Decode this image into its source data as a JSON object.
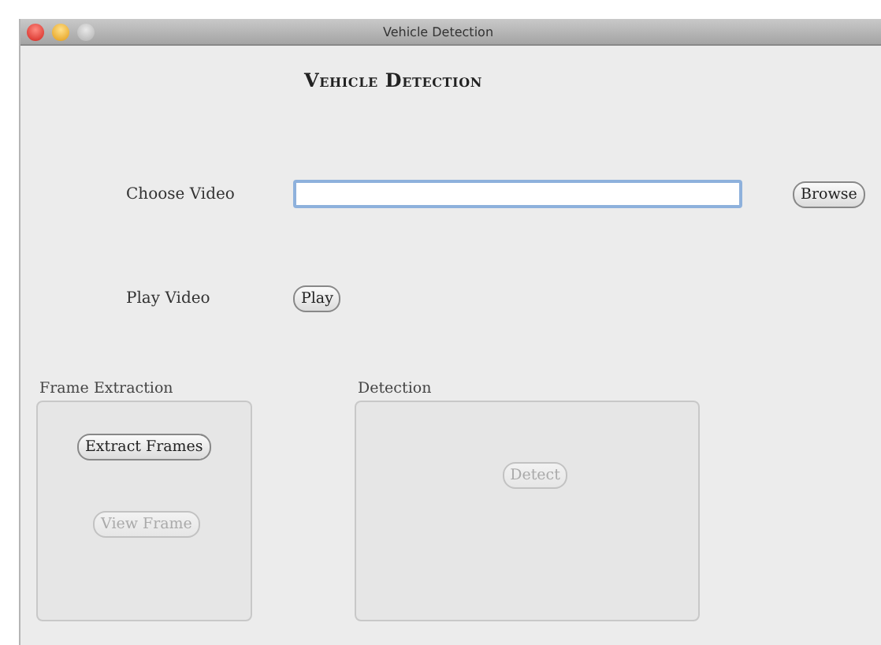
{
  "window": {
    "title": "Vehicle Detection"
  },
  "heading": "Vehicle Detection",
  "choose_video": {
    "label": "Choose Video",
    "button": {
      "label": "Browse",
      "disabled": false
    }
  },
  "play_video": {
    "label": "Play Video",
    "button": {
      "label": "Play",
      "disabled": false
    }
  },
  "panels": [
    {
      "title": "Frame Extraction",
      "kind": "extraction",
      "buttons": [
        {
          "label": "Extract Frames",
          "disabled": false
        },
        {
          "label": "View Frame",
          "disabled": true
        }
      ]
    },
    {
      "title": "Detection",
      "kind": "detection",
      "buttons": [
        {
          "label": "Detect",
          "disabled": true
        }
      ]
    }
  ]
}
